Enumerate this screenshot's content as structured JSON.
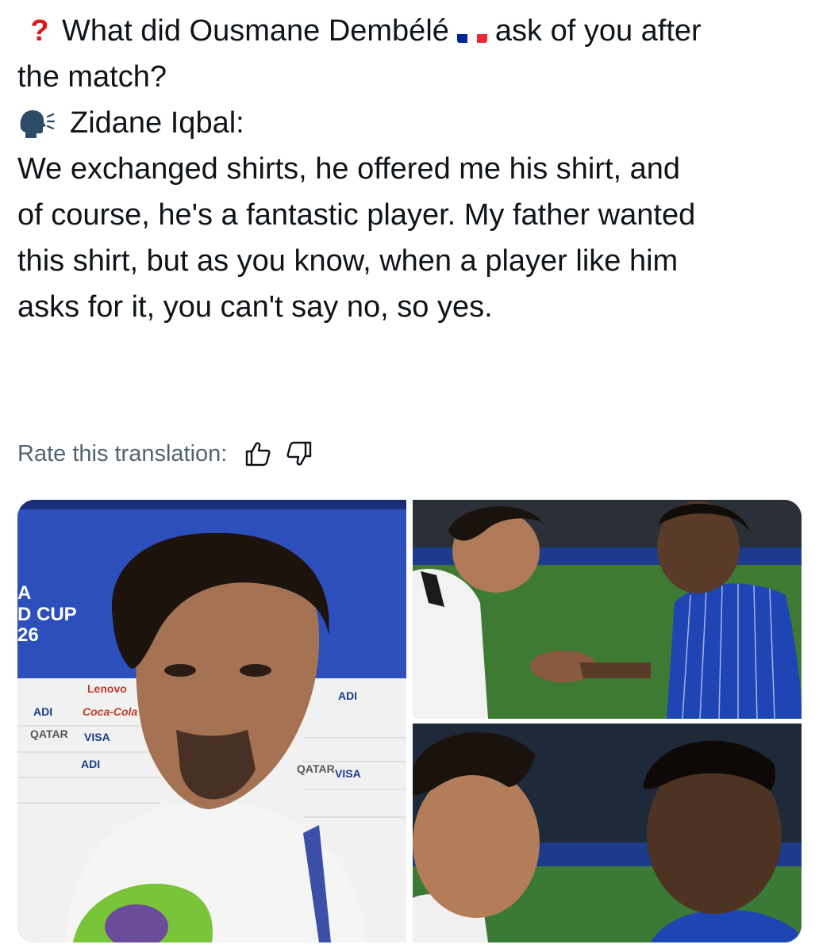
{
  "post": {
    "question_line1": "What did Ousmane Dembélé",
    "question_line1_end": "ask of you after",
    "question_line2": "the match?",
    "speaker_name": "Zidane Iqbal:",
    "answer_lines": [
      "We exchanged shirts, he offered me his shirt, and",
      "of course, he's a fantastic player. My father wanted",
      "this shirt, but as you know, when a player like him",
      "asks for it, you can't say no, so yes."
    ]
  },
  "translation": {
    "rate_label": "Rate this translation:"
  },
  "media": {
    "backdrop_cup_text": [
      "A",
      "D CUP",
      "26"
    ],
    "sponsor_texts": [
      "Lenovo",
      "ADI",
      "Coca-Cola",
      "QATAR",
      "VISA",
      "ADI",
      "ADI",
      "VISA",
      "QATAR"
    ]
  },
  "icons": {
    "question": "red-question-mark-icon",
    "flag": "france-flag-icon",
    "speaker": "speaking-head-icon",
    "thumbs_up": "thumbs-up-icon",
    "thumbs_down": "thumbs-down-icon"
  },
  "colors": {
    "text": "#0f1419",
    "muted": "#536471",
    "question_mark": "#d81b1b",
    "flag_blue": "#002395",
    "flag_red": "#ed2939"
  }
}
